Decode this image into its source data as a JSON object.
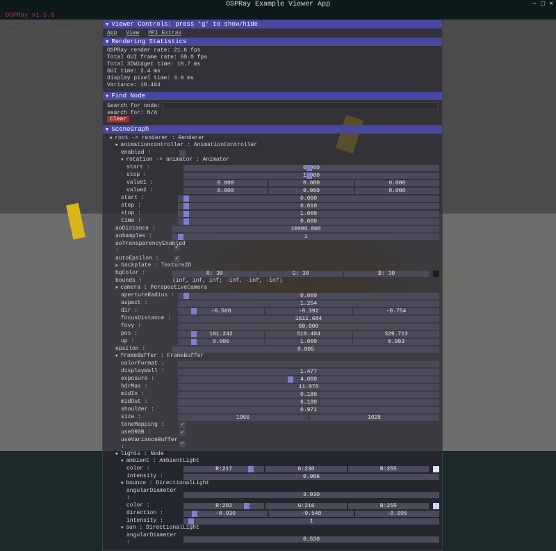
{
  "window": {
    "title": "OSPRay Example Viewer App"
  },
  "menubar": [
    "App",
    "View",
    "MPI Extras"
  ],
  "hud": {
    "line1": "OSPRay v1.5.0",
    "line2": "fps: 21.6317",
    "line3": "press 'g' for menus"
  },
  "panel": {
    "controls_hint": "Viewer Controls: press 'g' to show/hide",
    "menu_items": [
      "App",
      "View",
      "MPI Extras"
    ],
    "stats": {
      "title": "Rendering Statistics",
      "lines": [
        "OSPRay render rate: 21.6 fps",
        "Total GUI frame rate: 60.0 fps",
        "Total 3DWidget time: 16.7 ms",
        "GUI time: 2.4 ms",
        "display pixel time: 3.9 ms",
        "Variance: 10.464"
      ]
    },
    "find": {
      "title": "Find Node",
      "search_label": "Search for node:",
      "result_label": "search for: N/A",
      "clear": "Clear"
    },
    "scenegraph_title": "SceneGraph",
    "tree": {
      "root": "root -> renderer : Renderer",
      "animctrl": "animationcontroller : AnimationController",
      "enabled": "enabled :",
      "rotation": "rotation -> animator : Animator",
      "start": {
        "label": "start :",
        "v": "0.000"
      },
      "stop": {
        "label": "stop :",
        "v": "1.000"
      },
      "value1": {
        "label": "value1 :",
        "v": [
          "0.000",
          "0.000",
          "0.000"
        ]
      },
      "value2": {
        "label": "value2 :",
        "v": [
          "0.000",
          "0.000",
          "0.000"
        ]
      },
      "r_start": {
        "label": "start :",
        "v": "0.000"
      },
      "r_step": {
        "label": "step :",
        "v": "0.010"
      },
      "r_stop": {
        "label": "stop :",
        "v": "1.000"
      },
      "r_time": {
        "label": "time :",
        "v": "0.000"
      },
      "aoDistance": {
        "label": "aoDistance :",
        "v": "10000.000"
      },
      "aoSamples": {
        "label": "aoSamples :",
        "v": "1"
      },
      "aoTransparencyEnabled": {
        "label": "aoTransparencyEnabled :",
        "checked": true
      },
      "autoEpsilon": {
        "label": "autoEpsilon :",
        "checked": true
      },
      "backplate": {
        "label": "backplate : Texture2D"
      },
      "bgColor": {
        "label": "bgColor :",
        "v": [
          "R: 30",
          "G: 30",
          "B: 30"
        ]
      },
      "bounds": {
        "label": "bounds :",
        "v": "(inf, inf, inf; -inf, -inf, -inf)"
      },
      "camera": "camera : PerspectiveCamera",
      "apertureRadius": {
        "label": "apertureRadius :",
        "v": "0.000"
      },
      "aspect": {
        "label": "aspect :",
        "v": "1.254"
      },
      "dir": {
        "label": "dir :",
        "v": [
          "-0.560",
          "-0.392",
          "-0.754"
        ]
      },
      "focusDistance": {
        "label": "focusDistance :",
        "v": "1611.684"
      },
      "fovy": {
        "label": "fovy :",
        "v": "60.000"
      },
      "pos": {
        "label": "pos :",
        "v": [
          "191.242",
          "519.404",
          "329.713"
        ]
      },
      "up": {
        "label": "up :",
        "v": [
          "0.006",
          "1.000",
          "0.003"
        ]
      },
      "epsilon": {
        "label": "epsilon :",
        "v": "0.005"
      },
      "framebuffer": "frameBuffer : FrameBuffer",
      "colorFormat": {
        "label": "colorFormat :",
        "v": ""
      },
      "displayWall": {
        "label": "displayWall :",
        "v": "1.477"
      },
      "exposure": {
        "label": "exposure :",
        "v": "4.000"
      },
      "hdrMax": {
        "label": "hdrMax :",
        "v": "11.070"
      },
      "midIn": {
        "label": "midIn :",
        "v": "0.180"
      },
      "midOut": {
        "label": "midOut :",
        "v": "6.180"
      },
      "shoulder": {
        "label": "shoulder :",
        "v": "0.971"
      },
      "size": {
        "label": "size :",
        "v": [
          "1966",
          "1028"
        ]
      },
      "toneMapping": {
        "label": "toneMapping :",
        "checked": true
      },
      "useSRGB": {
        "label": "useSRGB :",
        "checked": true
      },
      "useVarianceBuffer": {
        "label": "useVarianceBuffer :",
        "checked": true
      },
      "lights": "lights : Node",
      "ambient": "ambient : AmbientLight",
      "ambColor": {
        "label": "color :",
        "v": [
          "R:217",
          "G:230",
          "B:255"
        ]
      },
      "ambIntensity": {
        "label": "intensity :",
        "v": "0.906"
      },
      "bounce": "bounce : DirectionalLight",
      "bAngular": {
        "label": "angularDiameter :",
        "v": "3.030"
      },
      "bColor": {
        "label": "color :",
        "v": [
          "R:202",
          "G:216",
          "B:255"
        ]
      },
      "bDirection": {
        "label": "direction :",
        "v": [
          "-0.930",
          "-0.540",
          "-0.605"
        ]
      },
      "bIntensity": {
        "label": "intensity :",
        "v": "1"
      },
      "sun": "sun : DirectionalLight",
      "sAngular": {
        "label": "angularDiameter :",
        "v": "0.530"
      }
    }
  }
}
